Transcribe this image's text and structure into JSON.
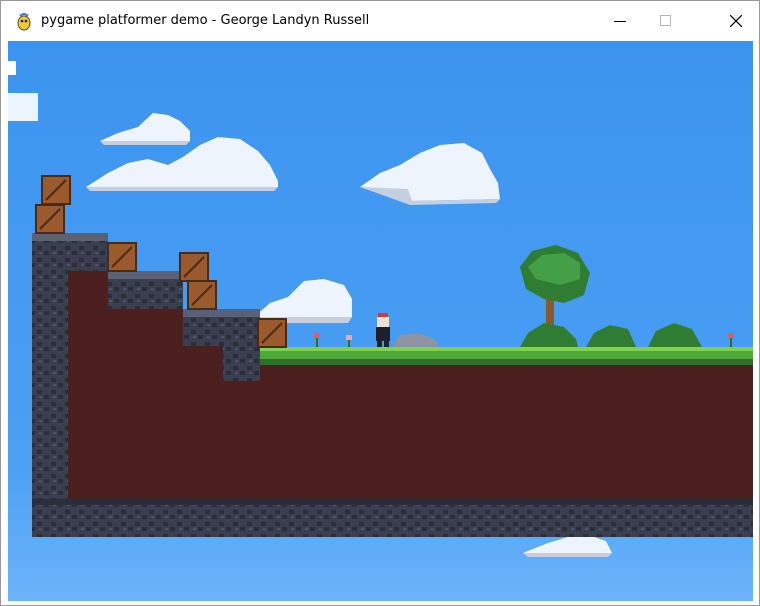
{
  "window": {
    "title": "pygame platformer demo - George Landyn Russell",
    "icon": "pygame-snake-icon",
    "controls": [
      "minimize-icon",
      "maximize-icon",
      "close-icon"
    ]
  },
  "scene": {
    "sky_color_top": "#3d94ee",
    "sky_color_bottom": "#6db3fb",
    "stone_color": "#3a3f4f",
    "dirt_color": "#4a1f1e",
    "grass_color": "#4fa83a",
    "crate_color": "#9a5a2e",
    "player": {
      "headband": "red",
      "outfit": "black"
    }
  }
}
